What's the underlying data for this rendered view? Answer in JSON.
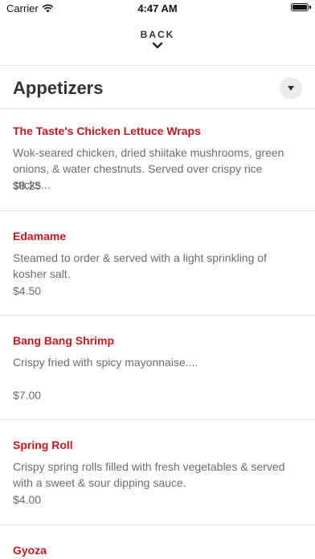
{
  "status": {
    "carrier": "Carrier",
    "time": "4:47 AM"
  },
  "nav": {
    "back_label": "BACK"
  },
  "section": {
    "title": "Appetizers"
  },
  "items": [
    {
      "name": "The Taste's Chicken Lettuce Wraps",
      "description": "Wok-seared chicken, dried shiitake mushrooms, green onions, & water chestnuts. Served over crispy rice sticks...",
      "price": "$8.25"
    },
    {
      "name": "Edamame",
      "description": "Steamed to order & served with a light sprinkling of kosher salt.",
      "price": "$4.50"
    },
    {
      "name": "Bang Bang Shrimp",
      "description": "Crispy fried with spicy mayonnaise....",
      "price": "$7.00"
    },
    {
      "name": "Spring Roll",
      "description": "Crispy spring rolls filled with fresh vegetables & served with a sweet & sour dipping sauce.",
      "price": "$4.00"
    },
    {
      "name": "Gyoza",
      "description": "",
      "price": ""
    }
  ],
  "colors": {
    "item_name": "#c8171e",
    "body_text": "#6d6d6d",
    "divider": "#e4e4e4"
  }
}
